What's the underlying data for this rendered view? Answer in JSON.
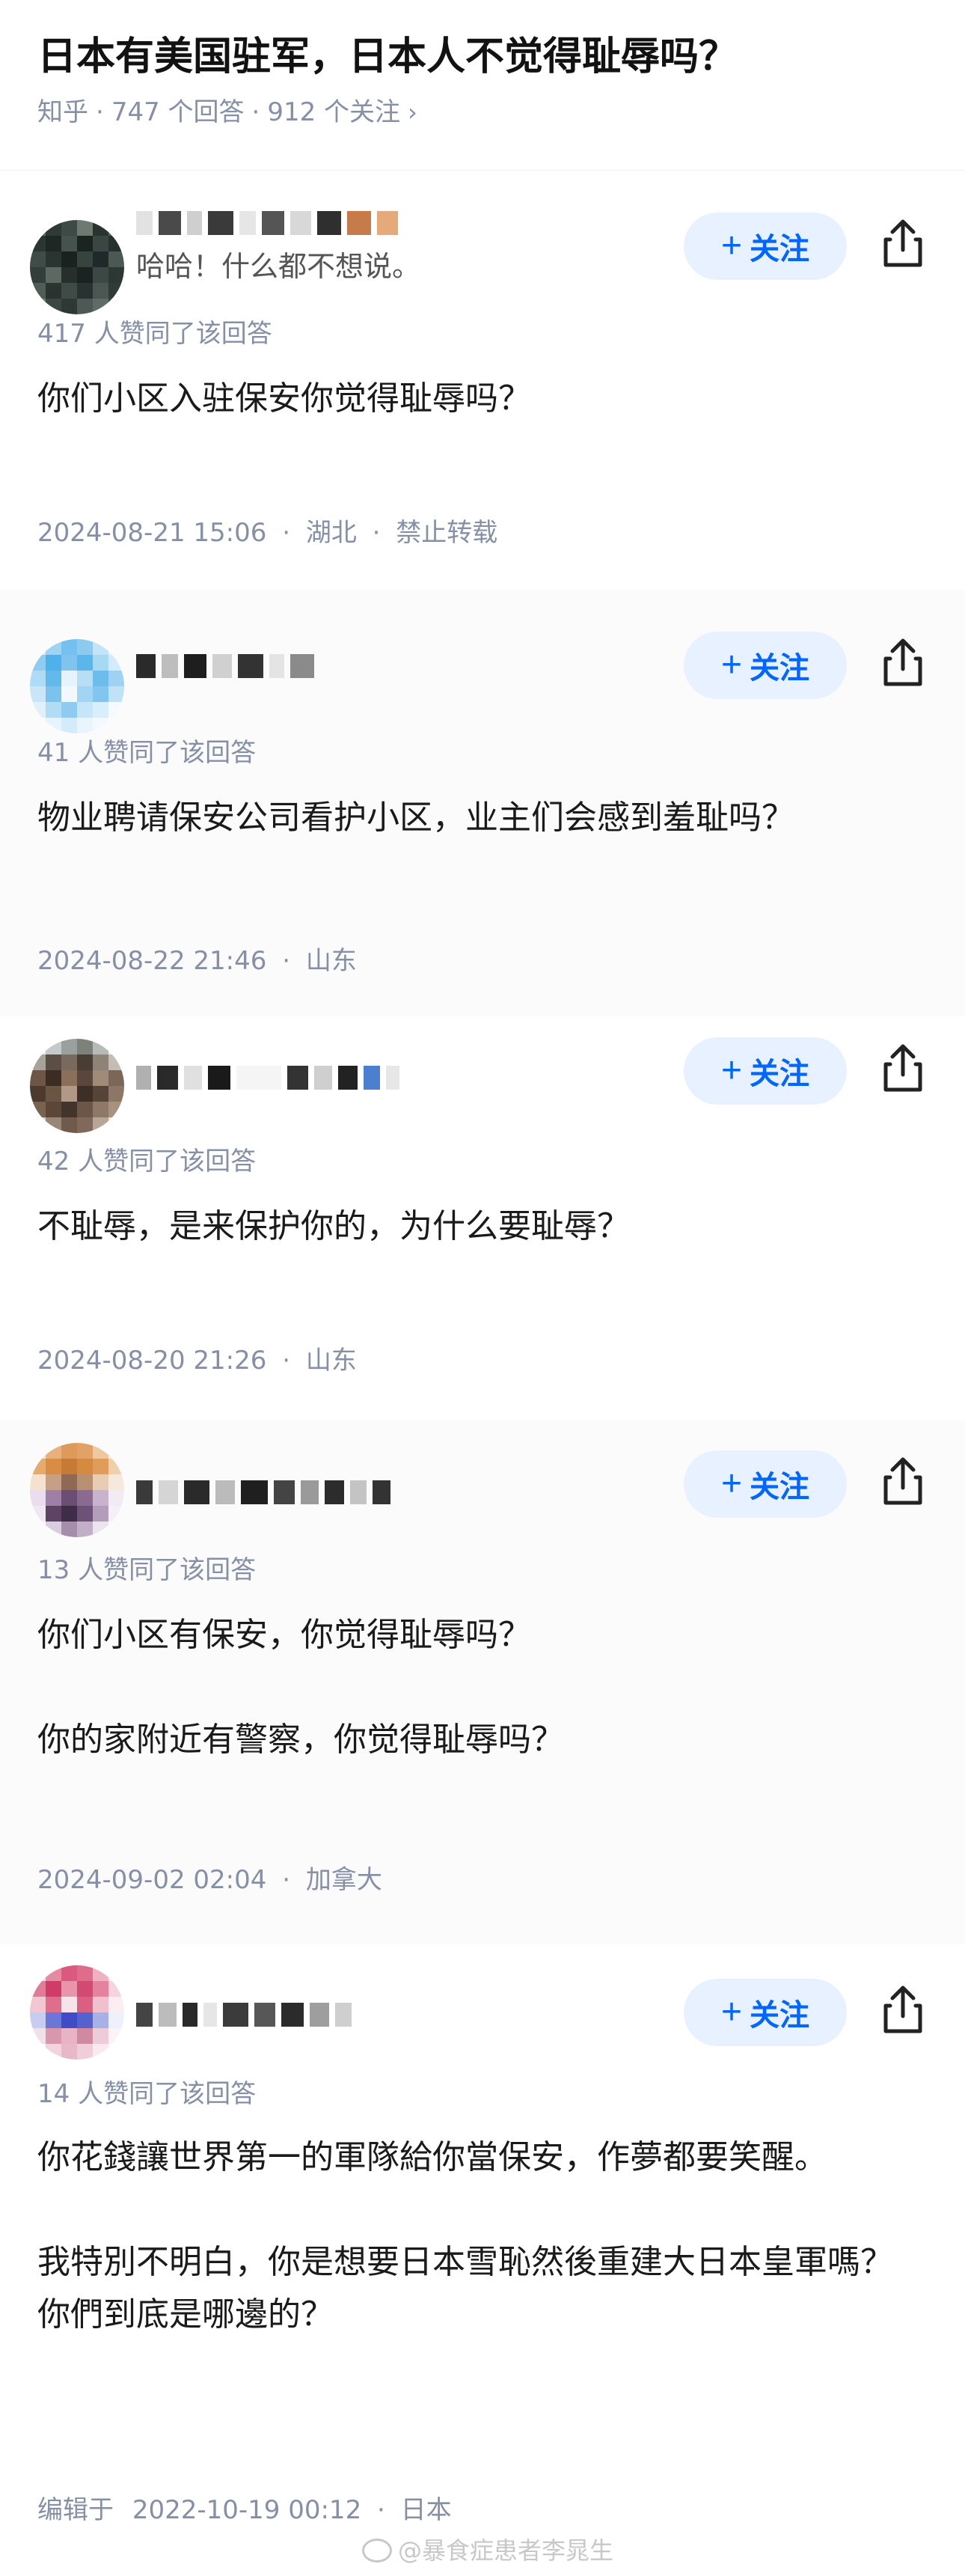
{
  "question": {
    "title": "日本有美国驻军，日本人不觉得耻辱吗？",
    "source": "知乎",
    "answers_count": "747 个回答",
    "followers_count": "912 个关注",
    "chevron": "›"
  },
  "common": {
    "follow_label": "关注",
    "follow_plus": "+",
    "share_icon": "share-icon",
    "meta_sep": "·"
  },
  "answers": [
    {
      "bio": "哈哈！什么都不想说。",
      "votes": "417 人赞同了该回答",
      "paragraphs": [
        "你们小区入驻保安你觉得耻辱吗？"
      ],
      "date": "2024-08-21 15:06",
      "location": "湖北",
      "extra": "禁止转载"
    },
    {
      "bio": "",
      "votes": "41 人赞同了该回答",
      "paragraphs": [
        "物业聘请保安公司看护小区，业主们会感到羞耻吗？"
      ],
      "date": "2024-08-22 21:46",
      "location": "山东",
      "extra": ""
    },
    {
      "bio": "",
      "votes": "42 人赞同了该回答",
      "paragraphs": [
        "不耻辱，是来保护你的，为什么要耻辱？"
      ],
      "date": "2024-08-20 21:26",
      "location": "山东",
      "extra": ""
    },
    {
      "bio": "",
      "votes": "13 人赞同了该回答",
      "paragraphs": [
        "你们小区有保安，你觉得耻辱吗？",
        "你的家附近有警察，你觉得耻辱吗？"
      ],
      "date": "2024-09-02 02:04",
      "location": "加拿大",
      "extra": ""
    },
    {
      "bio": "",
      "votes": "14 人赞同了该回答",
      "paragraphs": [
        "你花錢讓世界第一的軍隊給你當保安，作夢都要笑醒。",
        "我特別不明白，你是想要日本雪恥然後重建大日本皇軍嗎？你們到底是哪邊的？"
      ],
      "date_prefix": "编辑于",
      "date": "2022-10-19 00:12",
      "location": "日本",
      "extra": ""
    }
  ],
  "watermark": "@暴食症患者李晁生",
  "colors": {
    "accent": "#0066ff",
    "follow_bg": "#e8f1ff",
    "meta": "#8590a6"
  }
}
